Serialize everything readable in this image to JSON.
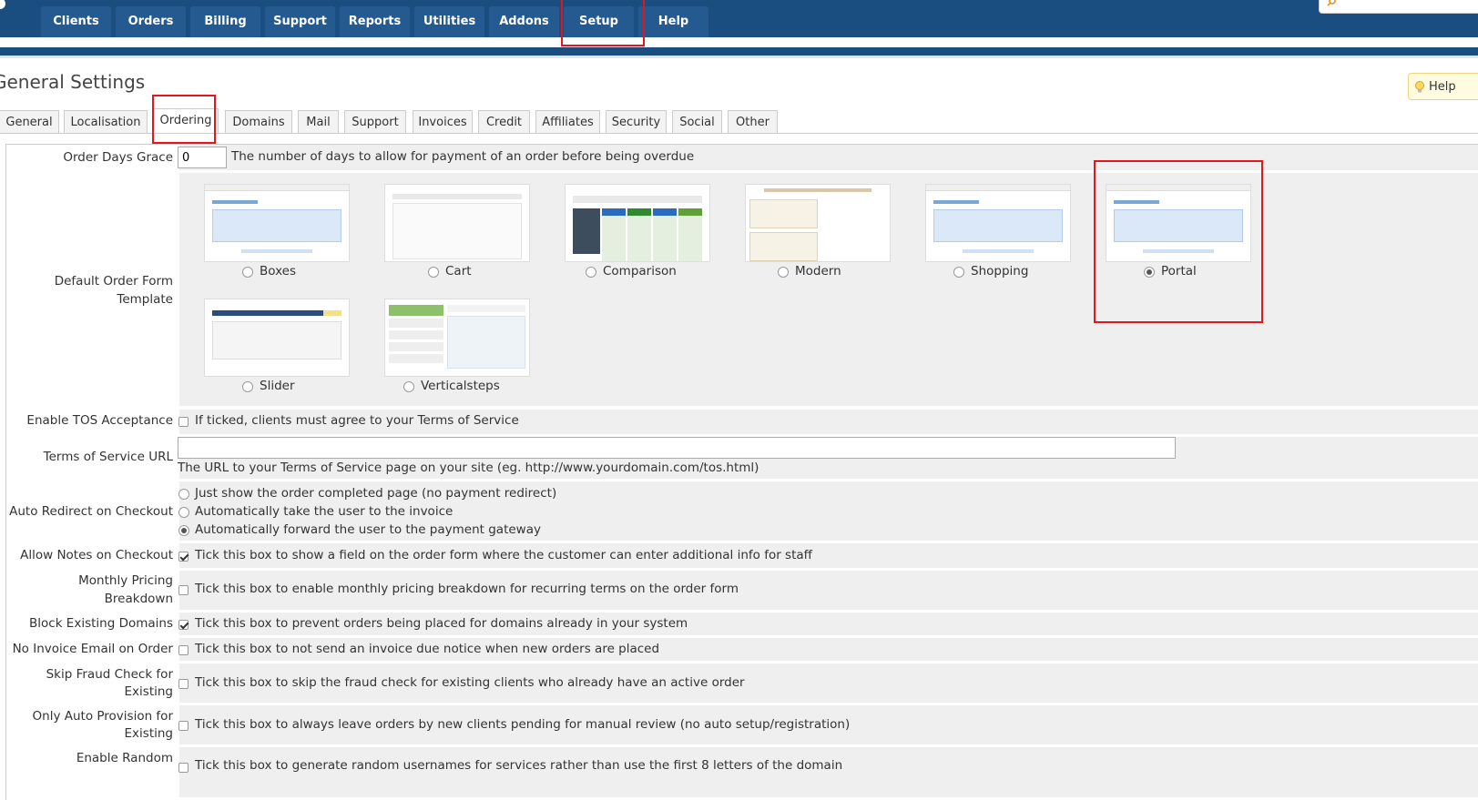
{
  "nav": {
    "tabs": [
      "Clients",
      "Orders",
      "Billing",
      "Support",
      "Reports",
      "Utilities",
      "Addons",
      "Setup",
      "Help"
    ]
  },
  "page": {
    "title": "General Settings",
    "help_label": "Help"
  },
  "subtabs": [
    "General",
    "Localisation",
    "Ordering",
    "Domains",
    "Mail",
    "Support",
    "Invoices",
    "Credit",
    "Affiliates",
    "Security",
    "Social",
    "Other"
  ],
  "settings": {
    "order_days_grace": {
      "label": "Order Days Grace",
      "value": "0",
      "desc": "The number of days to allow for payment of an order before being overdue"
    },
    "order_form": {
      "label": "Default Order Form Template",
      "templates": [
        "Boxes",
        "Cart",
        "Comparison",
        "Modern",
        "Shopping",
        "Portal",
        "Slider",
        "Verticalsteps"
      ],
      "selected": "Portal"
    },
    "tos_acceptance": {
      "label": "Enable TOS Acceptance",
      "desc": "If ticked, clients must agree to your Terms of Service"
    },
    "tos_url": {
      "label": "Terms of Service URL",
      "value": "",
      "desc": "The URL to your Terms of Service page on your site (eg. http://www.yourdomain.com/tos.html)"
    },
    "auto_redirect": {
      "label": "Auto Redirect on Checkout",
      "options": [
        "Just show the order completed page (no payment redirect)",
        "Automatically take the user to the invoice",
        "Automatically forward the user to the payment gateway"
      ]
    },
    "allow_notes": {
      "label": "Allow Notes on Checkout",
      "desc": "Tick this box to show a field on the order form where the customer can enter additional info for staff"
    },
    "monthly_pricing": {
      "label_1": "Monthly Pricing",
      "label_2": "Breakdown",
      "desc": "Tick this box to enable monthly pricing breakdown for recurring terms on the order form"
    },
    "block_domains": {
      "label": "Block Existing Domains",
      "desc": "Tick this box to prevent orders being placed for domains already in your system"
    },
    "no_invoice_email": {
      "label": "No Invoice Email on Order",
      "desc": "Tick this box to not send an invoice due notice when new orders are placed"
    },
    "skip_fraud": {
      "label_1": "Skip Fraud Check for",
      "label_2": "Existing",
      "desc": "Tick this box to skip the fraud check for existing clients who already have an active order"
    },
    "auto_provision": {
      "label_1": "Only Auto Provision for",
      "label_2": "Existing",
      "desc": "Tick this box to always leave orders by new clients pending for manual review (no auto setup/registration)"
    },
    "random_usernames": {
      "label": "Enable Random",
      "desc": "Tick this box to generate random usernames for services rather than use the first 8 letters of the domain"
    }
  },
  "colors": {
    "nav_bg": "#1a4d80",
    "nav_tab": "#245a8f",
    "highlight": "#e3161b",
    "row_bg": "#efefef"
  }
}
